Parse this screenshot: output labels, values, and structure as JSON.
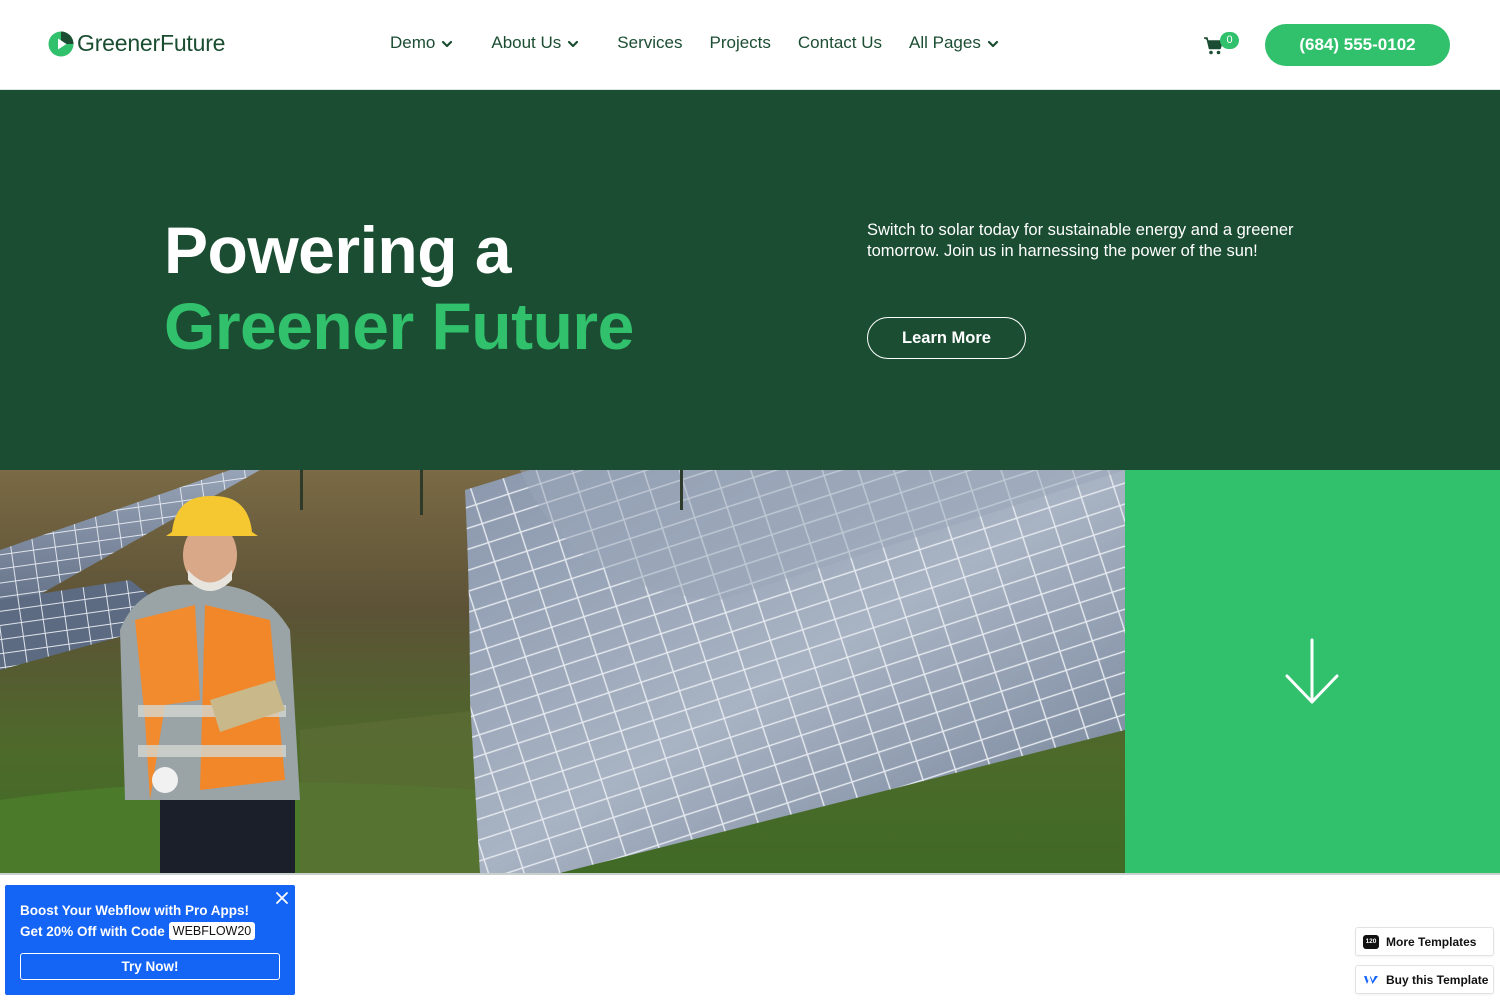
{
  "brand": {
    "name": "GreenerFuture",
    "accent": "#31c06b",
    "dark": "#1b4d32"
  },
  "header": {
    "nav": [
      {
        "label": "Demo",
        "dropdown": true
      },
      {
        "label": "About Us",
        "dropdown": true
      },
      {
        "label": "Services",
        "dropdown": false
      },
      {
        "label": "Projects",
        "dropdown": false
      },
      {
        "label": "Contact Us",
        "dropdown": false
      },
      {
        "label": "All Pages",
        "dropdown": true
      }
    ],
    "cart_count": "0",
    "phone": "(684) 555-0102"
  },
  "hero": {
    "title_line1": "Powering a",
    "title_line2": "Greener Future",
    "description": "Switch to solar today for sustainable energy and a greener tomorrow. Join us in harnessing the power of the sun!",
    "cta": "Learn More"
  },
  "promo": {
    "line1": "Boost Your Webflow with Pro Apps!",
    "line2": "Get 20% Off with Code",
    "code": "WEBFLOW20",
    "button": "Try Now!"
  },
  "template_badges": {
    "more": "More Templates",
    "more_icon_text": "120",
    "buy": "Buy this Template"
  }
}
